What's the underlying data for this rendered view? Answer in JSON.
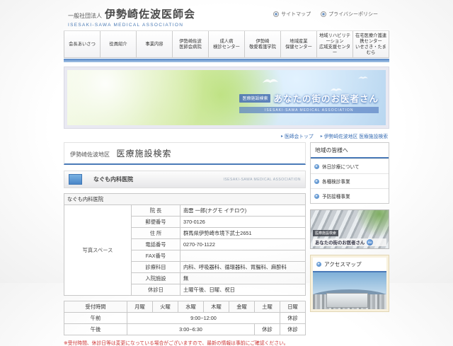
{
  "header": {
    "org_type": "一般社団法人",
    "org_name": "伊勢崎佐波医師会",
    "org_name_en": "ISESAKI-SAWA MEDICAL ASSOCIATION",
    "links": [
      {
        "label": "サイトマップ"
      },
      {
        "label": "プライバシーポリシー"
      }
    ]
  },
  "nav": {
    "items": [
      {
        "line1": "会長あいさつ",
        "line2": ""
      },
      {
        "line1": "役員紹介",
        "line2": ""
      },
      {
        "line1": "事業内容",
        "line2": ""
      },
      {
        "line1": "伊勢崎佐波",
        "line2": "医師会病院"
      },
      {
        "line1": "成人病",
        "line2": "検診センター"
      },
      {
        "line1": "伊勢崎",
        "line2": "敬愛看護学院"
      },
      {
        "line1": "地域産業",
        "line2": "保健センター"
      },
      {
        "line1": "地域リハビリテーション",
        "line2": "広域支援センター"
      },
      {
        "line1": "在宅医療介護連携センター",
        "line2": "いせさき・たまむら"
      }
    ]
  },
  "hero": {
    "badge": "医療施設検索",
    "title": "あなたの街のお医者さん",
    "subtitle": "ISESAKI-SAWA MEDICAL ASSOCIATION"
  },
  "breadcrumb": {
    "arrow": "▸",
    "items": [
      {
        "label": "医師会トップ"
      },
      {
        "label": "伊勢崎佐波地区 医療施設検索"
      }
    ]
  },
  "page": {
    "title_area": "伊勢崎佐波地区",
    "title_main": "医療施設検索"
  },
  "facility": {
    "name": "なぐも内科医院",
    "section_right_text": "ISESAKI-SAWA MEDICAL ASSOCIATION",
    "photo_placeholder": "写真スペース",
    "rows": [
      {
        "label": "院 長",
        "value": "南雲 一郎(ナグモ イチロウ)"
      },
      {
        "label": "郵便番号",
        "value": "370-0126"
      },
      {
        "label": "住 所",
        "value": "群馬県伊勢崎市境下武士2651"
      },
      {
        "label": "電話番号",
        "value": "0270-70-1122"
      },
      {
        "label": "FAX番号",
        "value": ""
      },
      {
        "label": "診療科目",
        "value": "内科、呼吸器科、循環器科、胃腸科、麻酔科"
      },
      {
        "label": "入院施設",
        "value": "無"
      },
      {
        "label": "休診日",
        "value": "土曜午後、日曜、祝日"
      }
    ]
  },
  "schedule": {
    "columns": [
      "受付時間",
      "月曜",
      "火曜",
      "水曜",
      "木曜",
      "金曜",
      "土曜",
      "日曜"
    ],
    "am": {
      "label": "午前",
      "time": "9:00~12:00",
      "sun": "休診"
    },
    "pm": {
      "label": "午後",
      "time": "3:00~6:30",
      "sat": "休診",
      "sun": "休診"
    },
    "note": "※受付時間、休診日等は変更になっている場合がございますので、最新の情報は事前にご確認ください。"
  },
  "sidebar": {
    "region_box": {
      "title": "地域の皆様へ",
      "items": [
        {
          "label": "休日診療について"
        },
        {
          "label": "各種検診事業"
        },
        {
          "label": "予防接種事業"
        }
      ]
    },
    "banner": {
      "badge": "医療施設検索",
      "title": "あなたの街のお医者さん",
      "button": "GO"
    },
    "access_map": {
      "title": "アクセスマップ"
    }
  },
  "colors": {
    "accent_blue": "#4a7ab8",
    "link_blue": "#3a6fb5",
    "note_red": "#cc3333"
  }
}
